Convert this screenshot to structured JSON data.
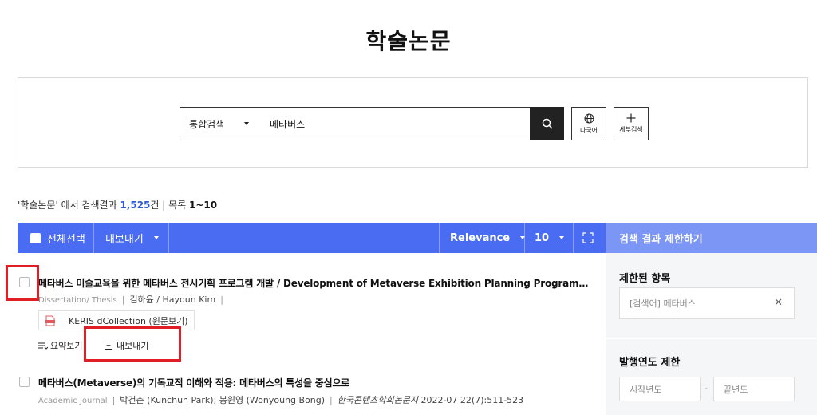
{
  "header": {
    "title": "학술논문"
  },
  "search": {
    "type_label": "통합검색",
    "query": "메타버스",
    "multi_lang_label": "다국어",
    "detail_search_label": "세부검색"
  },
  "summary": {
    "prefix": "'학술논문' 에서 검색결과 ",
    "count": "1,525",
    "suffix": "건 | 목록 ",
    "range": "1~10"
  },
  "toolbar": {
    "select_all": "전체선택",
    "export": "내보내기",
    "sort": "Relevance",
    "page_size": "10"
  },
  "sidebar": {
    "header": "검색 결과 제한하기",
    "applied_label": "제한된 항목",
    "applied_filter": "[검색어] 메타버스",
    "year_label": "발행연도 제한",
    "year_start_placeholder": "시작년도",
    "year_end_placeholder": "끝년도"
  },
  "results": [
    {
      "title": "메타버스 미술교육을 위한 메타버스 전시기획 프로그램 개발 / Development of Metaverse Exhibition Planning Program for Metaverse Art Education",
      "type": "Dissertation/ Thesis",
      "authors": "김하윤 / Hayoun Kim",
      "link": "KERIS dCollection (원문보기)",
      "summary_action": "요약보기",
      "export_action": "내보내기"
    },
    {
      "title": "메타버스(Metaverse)의 기독교적 이해와 적용: 메타버스의 특성을 중심으로",
      "type": "Academic Journal",
      "authors": "박건춘 (Kunchun Park); 봉원영 (Wonyoung Bong)",
      "journal": "한국콘텐츠학회논문지",
      "citation": "2022-07 22(7):511-523"
    }
  ],
  "colors": {
    "toolbar": "#4a6cf2",
    "side_header": "#7c96f6",
    "count": "#2f5bd8",
    "highlight": "#e01e26"
  }
}
